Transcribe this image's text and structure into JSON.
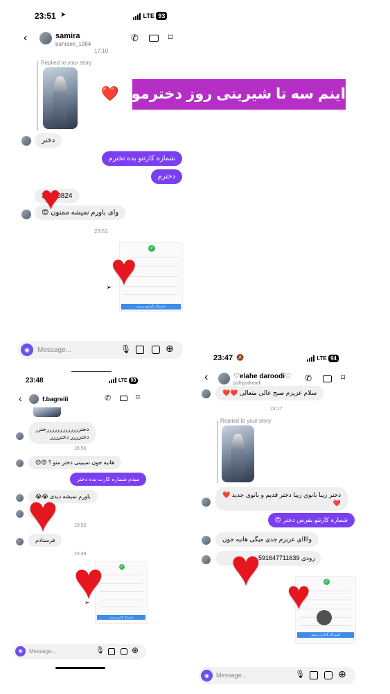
{
  "banner": {
    "text": "اینم سه تا شیرینی روز دخترمون❤️"
  },
  "screen1": {
    "status": {
      "time": "23:51",
      "network": "LTE",
      "battery": "93"
    },
    "header": {
      "name": "samira",
      "username": "bahrami_1984"
    },
    "timestamp_top": "17:10",
    "reply_label": "Replied to your story",
    "messages": {
      "m1": "دختر",
      "m2": "شماره کارتتو بده تخترم",
      "m3": "دخترم",
      "m4": "38220824",
      "m5": "وای باورم نمیشه ممنون 😍"
    },
    "timestamp_2": "23:51",
    "receipt_btn": "اشتراک گذاری رسید",
    "composer": {
      "placeholder": "Message..."
    }
  },
  "screen2": {
    "status": {
      "time": "23:48",
      "network": "LTE",
      "battery": "93"
    },
    "header": {
      "name": "f.bagreiii"
    },
    "messages": {
      "m1": "دخترررررررررررررخترر",
      "m1b": "دخترررر دخترررر",
      "m2": "هانیه جون نمیبینی دختر منو ؟ 😞😞",
      "m3": "میدم شماره کارت بده دختر",
      "m4": "باورم نمیشه دیدی 😭😭",
      "m5": "6",
      "m6": "فرستادم"
    },
    "timestamps": {
      "t1": "16:56",
      "t2": "19:53",
      "t3": "23:48"
    },
    "receipt_btn": "اشتراک گذاری رسید",
    "composer": {
      "placeholder": "Message..."
    }
  },
  "screen3": {
    "status": {
      "time": "23:47",
      "network": "LTE",
      "battery": "94"
    },
    "header": {
      "name": "♡elahe daroodi♡",
      "username": "pslhpsdroodi"
    },
    "messages": {
      "m1": "سلام عزیزم صبح عالی متعالی ❤️❤️",
      "m2": "دختر زیبا بانوی زیبا دختر قدیم و بانوی جدید ❤️",
      "m2b": "❤️",
      "m3": "شماره کارتتو بفرس دختر 😍",
      "m4": "واااای عزیزم جدی میگی هانیه جون",
      "m5": "591647711639",
      "m5b": "رودی"
    },
    "timestamp_1": "23:17",
    "reply_label": "Replied to your story",
    "receipt_btn": "اشتراک گذاری رسید",
    "composer": {
      "placeholder": "Message..."
    }
  },
  "colors": {
    "accent": "#7b3ff2",
    "banner": "#b52fc6",
    "heart": "#e5161d"
  },
  "icons": [
    "back-arrow-icon",
    "phone-icon",
    "video-icon",
    "tag-icon",
    "camera-icon",
    "mic-icon",
    "gallery-icon",
    "sticker-icon",
    "plus-icon",
    "share-icon",
    "heart-icon",
    "checkmark-icon"
  ]
}
